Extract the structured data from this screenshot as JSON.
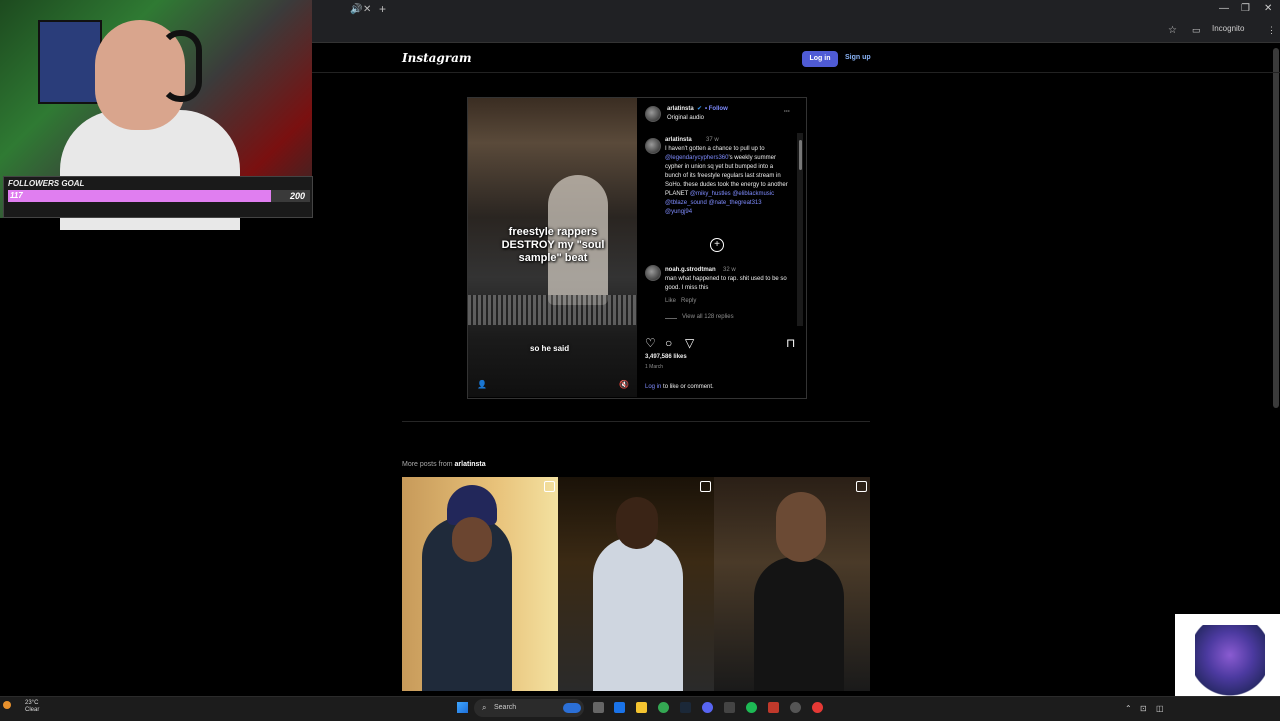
{
  "colors": {
    "accent_blue": "#4f5bd5",
    "link_blue": "#7f8cff",
    "goal_fill": "#e07ef0"
  },
  "stream_overlay": {
    "goal_label": "FOLLOWERS GOAL",
    "goal_current": "117",
    "goal_target": "200",
    "goal_progress_fraction": 0.87
  },
  "browser": {
    "incognito_label": "Incognito"
  },
  "instagram": {
    "logo": "Instagram",
    "login_label": "Log in",
    "signup_label": "Sign up"
  },
  "post": {
    "username": "arlatinsta",
    "follow_label": "• Follow",
    "audio_label": "Original audio",
    "more_label": "···",
    "video_caption": "freestyle rappers DESTROY my \"soul sample\" beat",
    "video_subtitle": "so he said",
    "caption_time": "37 w",
    "caption_text_1": "I haven't gotten a chance to pull up to",
    "caption_mention_1": "@legendarycyphers360",
    "caption_text_2": "'s weekly summer cypher in union sq yet but bumped into a bunch of its freestyle regulars last stream in SoHo. these dudes took the energy to another PLANET",
    "caption_mentions_2": "@miky_hustles @eliblackmusic @tblaze_sound @nate_thegreat313 @yungj94",
    "comment_user": "noah.g.strodtman",
    "comment_time": "32 w",
    "comment_text": "man what happened to rap. shit used to be so good. I miss this",
    "comment_like": "Like",
    "comment_reply": "Reply",
    "view_replies": "View all 128 replies",
    "likes": "3,497,586 likes",
    "date": "1 March",
    "login_link": "Log in",
    "login_suffix": "to like or comment."
  },
  "more_posts": {
    "prefix": "More posts from",
    "username": "arlatinsta"
  },
  "taskbar": {
    "weather_temp": "23°C",
    "weather_desc": "Clear",
    "search_label": "Search"
  }
}
